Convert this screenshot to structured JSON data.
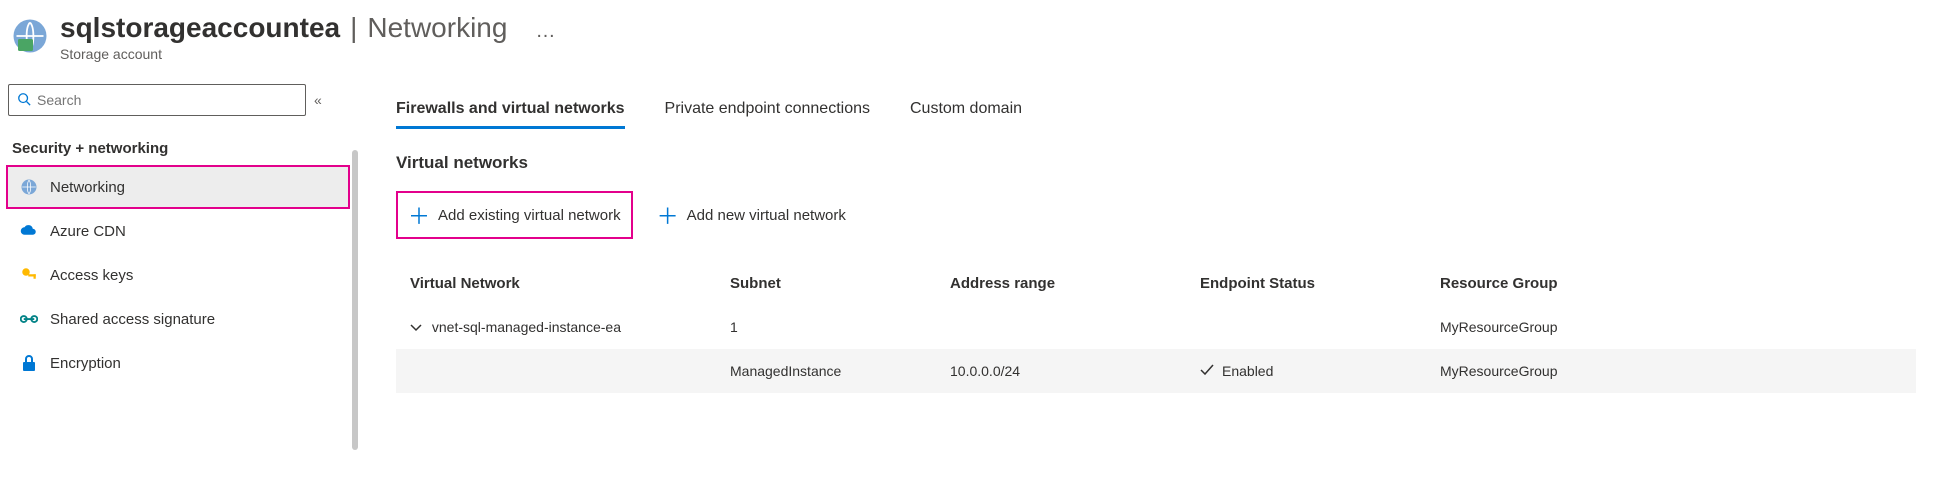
{
  "header": {
    "resource_name": "sqlstorageaccountea",
    "page_name": "Networking",
    "resource_type": "Storage account",
    "more": "…"
  },
  "sidebar": {
    "search_placeholder": "Search",
    "section_label": "Security + networking",
    "items": [
      {
        "label": "Networking"
      },
      {
        "label": "Azure CDN"
      },
      {
        "label": "Access keys"
      },
      {
        "label": "Shared access signature"
      },
      {
        "label": "Encryption"
      }
    ]
  },
  "tabs": [
    {
      "label": "Firewalls and virtual networks"
    },
    {
      "label": "Private endpoint connections"
    },
    {
      "label": "Custom domain"
    }
  ],
  "vnet_section": {
    "heading": "Virtual networks",
    "actions": {
      "add_existing": "Add existing virtual network",
      "add_new": "Add new virtual network"
    },
    "columns": {
      "c1": "Virtual Network",
      "c2": "Subnet",
      "c3": "Address range",
      "c4": "Endpoint Status",
      "c5": "Resource Group"
    },
    "rows": [
      {
        "vnet": "vnet-sql-managed-instance-ea",
        "subnet_count": "1",
        "resource_group": "MyResourceGroup"
      }
    ],
    "subrows": [
      {
        "subnet": "ManagedInstance",
        "address_range": "10.0.0.0/24",
        "endpoint_status": "Enabled",
        "resource_group": "MyResourceGroup"
      }
    ]
  }
}
